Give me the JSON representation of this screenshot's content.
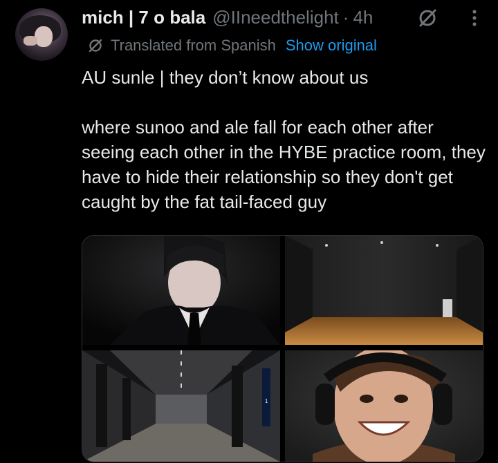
{
  "post": {
    "author": {
      "display_name": "mich | 7 o bala",
      "handle": "@IIneedthelight",
      "separator": "·",
      "time": "4h"
    },
    "translation": {
      "label": "Translated from Spanish",
      "action": "Show original"
    },
    "text": {
      "line1": "AU sunle | they don’t know about us",
      "line2": "where sunoo and ale fall for each other after seeing each other in the HYBE practice room, they have to hide their relationship so they don't get caught by the fat tail-faced guy"
    },
    "media": [
      {
        "icon": "photo-icon"
      },
      {
        "icon": "photo-icon"
      },
      {
        "icon": "photo-icon"
      },
      {
        "icon": "photo-icon"
      }
    ]
  },
  "colors": {
    "background": "#000000",
    "text_primary": "#e7e9ea",
    "text_secondary": "#71767b",
    "link": "#1d9bf0",
    "border": "#2f3336"
  }
}
